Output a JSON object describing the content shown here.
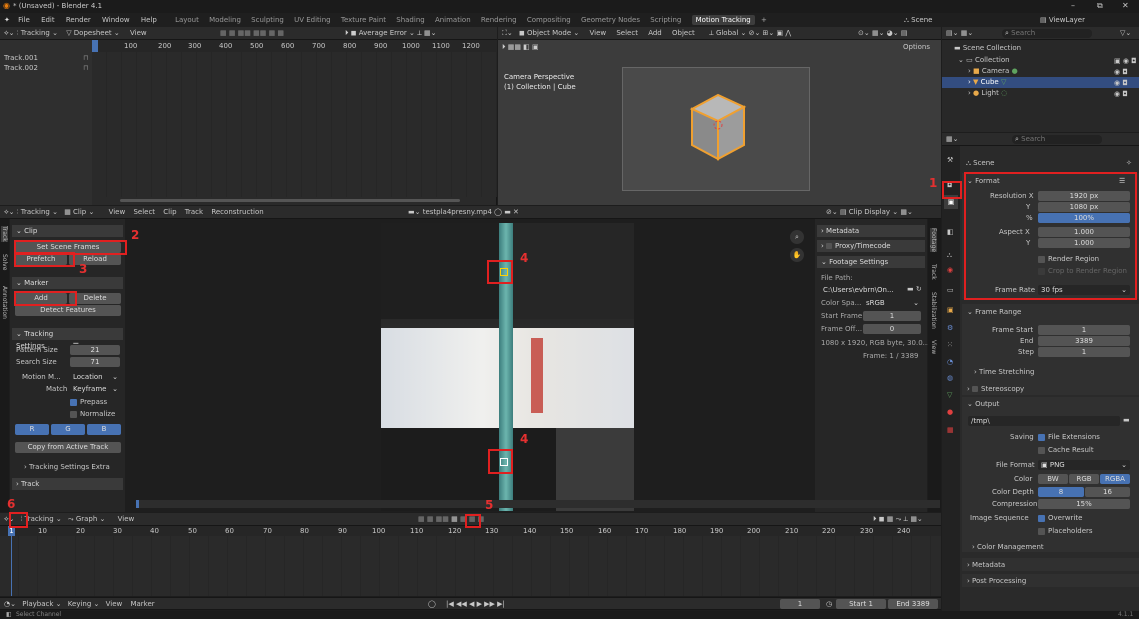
{
  "window": {
    "title": "* (Unsaved) - Blender 4.1",
    "min": "–",
    "max": "⧉",
    "close": "✕"
  },
  "menu": {
    "items": [
      "File",
      "Edit",
      "Render",
      "Window",
      "Help"
    ],
    "workspaces": [
      "Layout",
      "Modeling",
      "Sculpting",
      "UV Editing",
      "Texture Paint",
      "Shading",
      "Animation",
      "Rendering",
      "Compositing",
      "Geometry Nodes",
      "Scripting"
    ],
    "active_ws": "Motion Tracking",
    "add": "+",
    "scene": "Scene",
    "viewlayer": "ViewLayer"
  },
  "dope": {
    "mode": "Tracking",
    "editor": "Dopesheet",
    "view": "View",
    "sort": "Average Error",
    "frames": [
      "100",
      "200",
      "300",
      "400",
      "500",
      "600",
      "700",
      "800",
      "900",
      "1000",
      "1100",
      "1200"
    ],
    "tracks": [
      "Track.001",
      "Track.002"
    ]
  },
  "viewport": {
    "mode": "Object Mode",
    "menus": [
      "View",
      "Select",
      "Add",
      "Object"
    ],
    "orient": "Global",
    "options": "Options",
    "persp": "Camera Perspective",
    "coll": "(1) Collection | Cube"
  },
  "outliner": {
    "search": "Search",
    "root": "Scene Collection",
    "items": [
      {
        "name": "Collection"
      },
      {
        "name": "Camera"
      },
      {
        "name": "Cube"
      },
      {
        "name": "Light"
      }
    ]
  },
  "clip": {
    "mode": "Tracking",
    "editor": "Clip",
    "menus": [
      "View",
      "Select",
      "Clip",
      "Track",
      "Reconstruction"
    ],
    "file": "testpla4presny.mp4",
    "display": "Clip Display"
  },
  "tools": {
    "clip_hdr": "Clip",
    "set_scene": "Set Scene Frames",
    "prefetch": "Prefetch",
    "reload": "Reload",
    "marker_hdr": "Marker",
    "add": "Add",
    "delete": "Delete",
    "detect": "Detect Features",
    "ts_hdr": "Tracking Settings",
    "pattern_lbl": "Pattern Size",
    "pattern_val": "21",
    "search_lbl": "Search Size",
    "search_val": "71",
    "motion_lbl": "Motion M...",
    "motion_val": "Location",
    "match_lbl": "Match",
    "match_val": "Keyframe",
    "prepass": "Prepass",
    "normalize": "Normalize",
    "r": "R",
    "g": "G",
    "b": "B",
    "copy": "Copy from Active Track",
    "tse": "Tracking Settings Extra",
    "track": "Track"
  },
  "tabs": {
    "left": [
      "Track",
      "Solve",
      "Annotation"
    ],
    "right": [
      "Footage",
      "Track",
      "Stabilization",
      "View"
    ]
  },
  "footage": {
    "metadata": "Metadata",
    "proxy": "Proxy/Timecode",
    "fs": "Footage Settings",
    "path_lbl": "File Path:",
    "path": "C:\\Users\\evbrn\\On...",
    "cs_lbl": "Color Spa...",
    "cs_val": "sRGB",
    "sf_lbl": "Start Frame",
    "sf_val": "1",
    "fo_lbl": "Frame Off...",
    "fo_val": "0",
    "info": "1080 x 1920, RGB byte, 30.0...",
    "frame": "Frame: 1 / 3389"
  },
  "graph": {
    "mode": "Tracking",
    "editor": "Graph",
    "view": "View",
    "frames": [
      "10",
      "20",
      "30",
      "40",
      "50",
      "60",
      "70",
      "80",
      "90",
      "100",
      "110",
      "120",
      "130",
      "140",
      "150",
      "160",
      "170",
      "180",
      "190",
      "200",
      "210",
      "220",
      "230",
      "240"
    ]
  },
  "timeline": {
    "playback": "Playback",
    "keying": "Keying",
    "view": "View",
    "marker": "Marker",
    "cur": "1",
    "start_lbl": "Start",
    "start": "1",
    "end_lbl": "End",
    "end": "3389"
  },
  "status": {
    "left": "Select Channel",
    "ver": "4.1.1"
  },
  "props": {
    "search": "Search",
    "scene": "Scene",
    "format": "Format",
    "resx_lbl": "Resolution X",
    "resx": "1920 px",
    "resy_lbl": "Y",
    "resy": "1080 px",
    "pct_lbl": "%",
    "pct": "100%",
    "aspx_lbl": "Aspect X",
    "aspx": "1.000",
    "aspy_lbl": "Y",
    "aspy": "1.000",
    "rr": "Render Region",
    "crop": "Crop to Render Region",
    "fr_lbl": "Frame Rate",
    "fr": "30 fps",
    "range": "Frame Range",
    "fs_lbl": "Frame Start",
    "fs": "1",
    "end_lbl": "End",
    "end": "3389",
    "step_lbl": "Step",
    "step": "1",
    "ts": "Time Stretching",
    "stereo": "Stereoscopy",
    "output": "Output",
    "path": "/tmp\\",
    "saving": "Saving",
    "fe": "File Extensions",
    "cache": "Cache Result",
    "ff_lbl": "File Format",
    "ff": "PNG",
    "color_lbl": "Color",
    "bw": "BW",
    "rgb": "RGB",
    "rgba": "RGBA",
    "cd_lbl": "Color Depth",
    "cd8": "8",
    "cd16": "16",
    "comp_lbl": "Compression",
    "comp": "15%",
    "seq_lbl": "Image Sequence",
    "overwrite": "Overwrite",
    "ph": "Placeholders",
    "cm": "Color Management",
    "meta": "Metadata",
    "post": "Post Processing"
  },
  "annotations": [
    "1",
    "2",
    "3",
    "4",
    "4",
    "5",
    "6"
  ]
}
